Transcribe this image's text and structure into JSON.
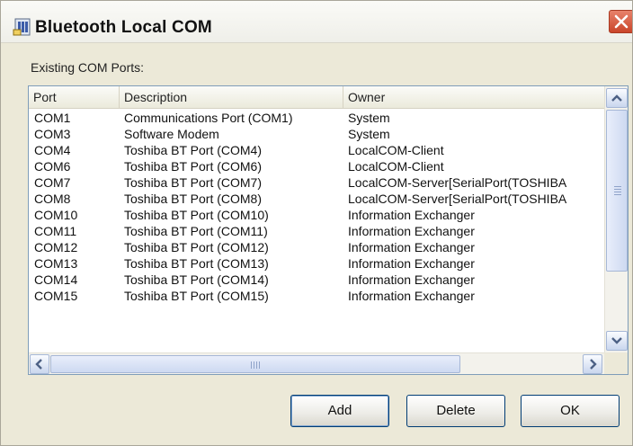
{
  "window": {
    "title": "Bluetooth Local COM",
    "app_icon": "bluetooth-com-icon",
    "close_icon": "close-icon",
    "accent_close": "#d4502f"
  },
  "section_label": "Existing COM Ports:",
  "list": {
    "columns": [
      "Port",
      "Description",
      "Owner"
    ],
    "rows": [
      [
        "COM1",
        "Communications Port (COM1)",
        "System"
      ],
      [
        "COM3",
        "Software Modem",
        "System"
      ],
      [
        "COM4",
        "Toshiba BT Port (COM4)",
        "LocalCOM-Client"
      ],
      [
        "COM6",
        "Toshiba BT Port (COM6)",
        "LocalCOM-Client"
      ],
      [
        "COM7",
        "Toshiba BT Port (COM7)",
        "LocalCOM-Server[SerialPort(TOSHIBA"
      ],
      [
        "COM8",
        "Toshiba BT Port (COM8)",
        "LocalCOM-Server[SerialPort(TOSHIBA"
      ],
      [
        "COM10",
        "Toshiba BT Port (COM10)",
        "Information Exchanger"
      ],
      [
        "COM11",
        "Toshiba BT Port (COM11)",
        "Information Exchanger"
      ],
      [
        "COM12",
        "Toshiba BT Port (COM12)",
        "Information Exchanger"
      ],
      [
        "COM13",
        "Toshiba BT Port (COM13)",
        "Information Exchanger"
      ],
      [
        "COM14",
        "Toshiba BT Port (COM14)",
        "Information Exchanger"
      ],
      [
        "COM15",
        "Toshiba BT Port (COM15)",
        "Information Exchanger"
      ]
    ]
  },
  "buttons": {
    "add": "Add",
    "delete": "Delete",
    "ok": "OK"
  }
}
